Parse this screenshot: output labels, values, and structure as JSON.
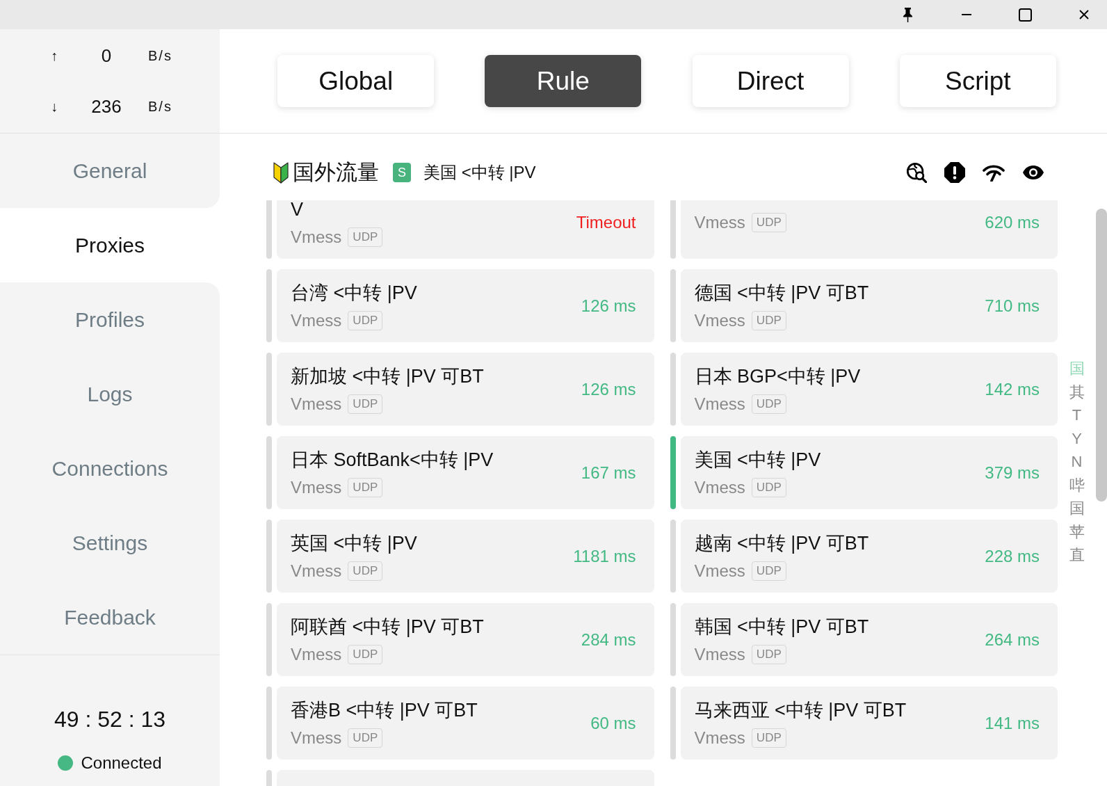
{
  "traffic": [
    {
      "arrow": "↑",
      "value": "0",
      "unit": "B/s"
    },
    {
      "arrow": "↓",
      "value": "236",
      "unit": "B/s"
    }
  ],
  "nav": [
    {
      "label": "General",
      "selected": false
    },
    {
      "label": "Proxies",
      "selected": true
    },
    {
      "label": "Profiles",
      "selected": false
    },
    {
      "label": "Logs",
      "selected": false
    },
    {
      "label": "Connections",
      "selected": false
    },
    {
      "label": "Settings",
      "selected": false
    },
    {
      "label": "Feedback",
      "selected": false
    }
  ],
  "uptime": "49 : 52 : 13",
  "status": {
    "label": "Connected",
    "connected": true
  },
  "modes": [
    {
      "label": "Global",
      "selected": false
    },
    {
      "label": "Rule",
      "selected": true
    },
    {
      "label": "Direct",
      "selected": false
    },
    {
      "label": "Script",
      "selected": false
    }
  ],
  "group": {
    "name": "国外流量",
    "type_badge": "S",
    "current": "美国 <中转 |PV"
  },
  "proxies": [
    {
      "name": "V",
      "protocol": "Vmess",
      "tags": [
        "UDP"
      ],
      "latency": "Timeout",
      "timeout": true,
      "selected": false
    },
    {
      "protocol": "Vmess",
      "tags": [
        "UDP"
      ],
      "latency": "620 ms",
      "timeout": false,
      "selected": false
    },
    {
      "name": "台湾 <中转 |PV",
      "protocol": "Vmess",
      "tags": [
        "UDP"
      ],
      "latency": "126 ms",
      "timeout": false,
      "selected": false
    },
    {
      "name": "德国 <中转 |PV 可BT",
      "protocol": "Vmess",
      "tags": [
        "UDP"
      ],
      "latency": "710 ms",
      "timeout": false,
      "selected": false
    },
    {
      "name": "新加坡 <中转 |PV 可BT",
      "protocol": "Vmess",
      "tags": [
        "UDP"
      ],
      "latency": "126 ms",
      "timeout": false,
      "selected": false
    },
    {
      "name": "日本 BGP<中转 |PV",
      "protocol": "Vmess",
      "tags": [
        "UDP"
      ],
      "latency": "142 ms",
      "timeout": false,
      "selected": false
    },
    {
      "name": "日本 SoftBank<中转 |PV",
      "protocol": "Vmess",
      "tags": [
        "UDP"
      ],
      "latency": "167 ms",
      "timeout": false,
      "selected": false
    },
    {
      "name": "美国 <中转 |PV",
      "protocol": "Vmess",
      "tags": [
        "UDP"
      ],
      "latency": "379 ms",
      "timeout": false,
      "selected": true
    },
    {
      "name": "英国 <中转 |PV",
      "protocol": "Vmess",
      "tags": [
        "UDP"
      ],
      "latency": "1181 ms",
      "timeout": false,
      "selected": false
    },
    {
      "name": "越南 <中转 |PV 可BT",
      "protocol": "Vmess",
      "tags": [
        "UDP"
      ],
      "latency": "228 ms",
      "timeout": false,
      "selected": false
    },
    {
      "name": "阿联酋 <中转 |PV 可BT",
      "protocol": "Vmess",
      "tags": [
        "UDP"
      ],
      "latency": "284 ms",
      "timeout": false,
      "selected": false
    },
    {
      "name": "韩国 <中转 |PV 可BT",
      "protocol": "Vmess",
      "tags": [
        "UDP"
      ],
      "latency": "264 ms",
      "timeout": false,
      "selected": false
    },
    {
      "name": "香港B <中转 |PV 可BT",
      "protocol": "Vmess",
      "tags": [
        "UDP"
      ],
      "latency": "60 ms",
      "timeout": false,
      "selected": false
    },
    {
      "name": "马来西亚 <中转 |PV 可BT",
      "protocol": "Vmess",
      "tags": [
        "UDP"
      ],
      "latency": "141 ms",
      "timeout": false,
      "selected": false
    },
    {
      "selected": false
    }
  ],
  "index": [
    {
      "label": "国",
      "selected": true
    },
    {
      "label": "其",
      "selected": false
    },
    {
      "label": "T",
      "selected": false
    },
    {
      "label": "Y",
      "selected": false
    },
    {
      "label": "N",
      "selected": false
    },
    {
      "label": "哔",
      "selected": false
    },
    {
      "label": "国",
      "selected": false
    },
    {
      "label": "苹",
      "selected": false
    },
    {
      "label": "直",
      "selected": false
    }
  ]
}
